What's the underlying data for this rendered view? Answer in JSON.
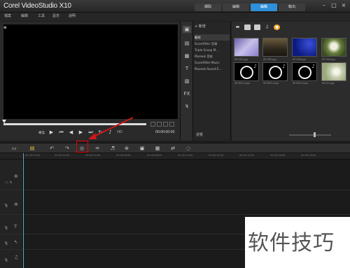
{
  "app": {
    "title": "Corel VideoStudio X10"
  },
  "window_controls": [
    "–",
    "□",
    "×"
  ],
  "menu": {
    "items": [
      "檔案",
      "編輯",
      "工具",
      "設定",
      "說明"
    ]
  },
  "step_tabs": [
    {
      "label": "擷取",
      "active": false
    },
    {
      "label": "編輯",
      "active": false
    },
    {
      "label": "編輯",
      "active": true
    },
    {
      "label": "輸出",
      "active": false
    }
  ],
  "player": {
    "mode_label": "專案",
    "quality_label": "HD",
    "timecode": "00:00:00:00"
  },
  "library": {
    "add_label": "新增",
    "browse_label": "瀏覽",
    "folders": [
      {
        "label": "範例",
        "active": true
      },
      {
        "label": "ScoreFitter 音樂",
        "active": false
      },
      {
        "label": "Triple Scoop M...",
        "active": false
      },
      {
        "label": "Muzeek 音效",
        "active": false
      },
      {
        "label": "ScoreFitter Music",
        "active": false
      },
      {
        "label": "Muzeek Sound E...",
        "active": false
      }
    ],
    "thumbnails": [
      {
        "label": "SP-V01.jpg",
        "type": "purple"
      },
      {
        "label": "SP-V02.jpg",
        "type": "dark"
      },
      {
        "label": "SP-V03.jpg",
        "type": "blue"
      },
      {
        "label": "SP-V04.jpg",
        "type": "green"
      },
      {
        "label": "SP-M01.mpa",
        "type": "vinyl"
      },
      {
        "label": "SP-M02.mpa",
        "type": "vinyl"
      },
      {
        "label": "SP-M03.mpa",
        "type": "vinyl"
      },
      {
        "label": "SP-I01.jpg",
        "type": "dandelion"
      }
    ]
  },
  "watermark": "软件技巧",
  "colors": {
    "accent": "#2f8fd8",
    "highlight": "#e00000",
    "arrow": "#d01818"
  }
}
